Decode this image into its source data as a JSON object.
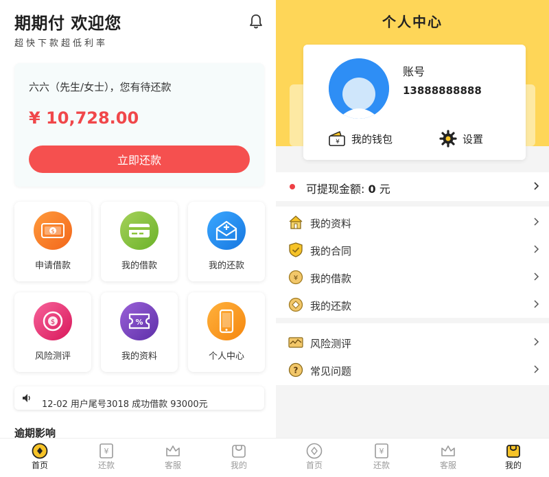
{
  "left": {
    "title": "期期付 欢迎您",
    "subtitle": "超快下款超低利率",
    "due_card": {
      "text": "六六（先生/女士），您有待还款",
      "amount": "¥ 10,728.00",
      "button": "立即还款"
    },
    "tiles": [
      {
        "label": "申请借款",
        "icon": "money-bill-icon",
        "color": "#f87b21"
      },
      {
        "label": "我的借款",
        "icon": "card-icon",
        "color": "#8cc43c"
      },
      {
        "label": "我的还款",
        "icon": "mail-plus-icon",
        "color": "#1f8ff0"
      },
      {
        "label": "风险测评",
        "icon": "coin-icon",
        "color": "#ea3a70"
      },
      {
        "label": "我的资料",
        "icon": "ticket-icon",
        "color": "#7b45c2"
      },
      {
        "label": "个人中心",
        "icon": "phone-icon",
        "color": "#f89a1c"
      }
    ],
    "notice": "12-02 用户尾号3018 成功借款 93000元",
    "section_title": "逾期影响",
    "tabs": [
      {
        "label": "首页",
        "active": true
      },
      {
        "label": "还款",
        "active": false
      },
      {
        "label": "客服",
        "active": false
      },
      {
        "label": "我的",
        "active": false
      }
    ]
  },
  "right": {
    "title": "个人中心",
    "account_label": "账号",
    "account_number": "13888888888",
    "wallet_label": "我的钱包",
    "settings_label": "设置",
    "balance": {
      "label": "可提现金额:",
      "value": "0",
      "unit": "元"
    },
    "menu_group_1": [
      {
        "label": "我的资料",
        "icon": "house-icon"
      },
      {
        "label": "我的合同",
        "icon": "shield-check-icon"
      },
      {
        "label": "我的借款",
        "icon": "yen-coin-icon"
      },
      {
        "label": "我的还款",
        "icon": "diamond-coin-icon"
      }
    ],
    "menu_group_2": [
      {
        "label": "风险测评",
        "icon": "chart-card-icon"
      },
      {
        "label": "常见问题",
        "icon": "question-icon"
      }
    ],
    "tabs": [
      {
        "label": "首页",
        "active": false
      },
      {
        "label": "还款",
        "active": false
      },
      {
        "label": "客服",
        "active": false
      },
      {
        "label": "我的",
        "active": true
      }
    ]
  },
  "colors": {
    "accent_red": "#f5504f",
    "brand_yellow": "#fed658",
    "tab_active": "#f6c328"
  }
}
